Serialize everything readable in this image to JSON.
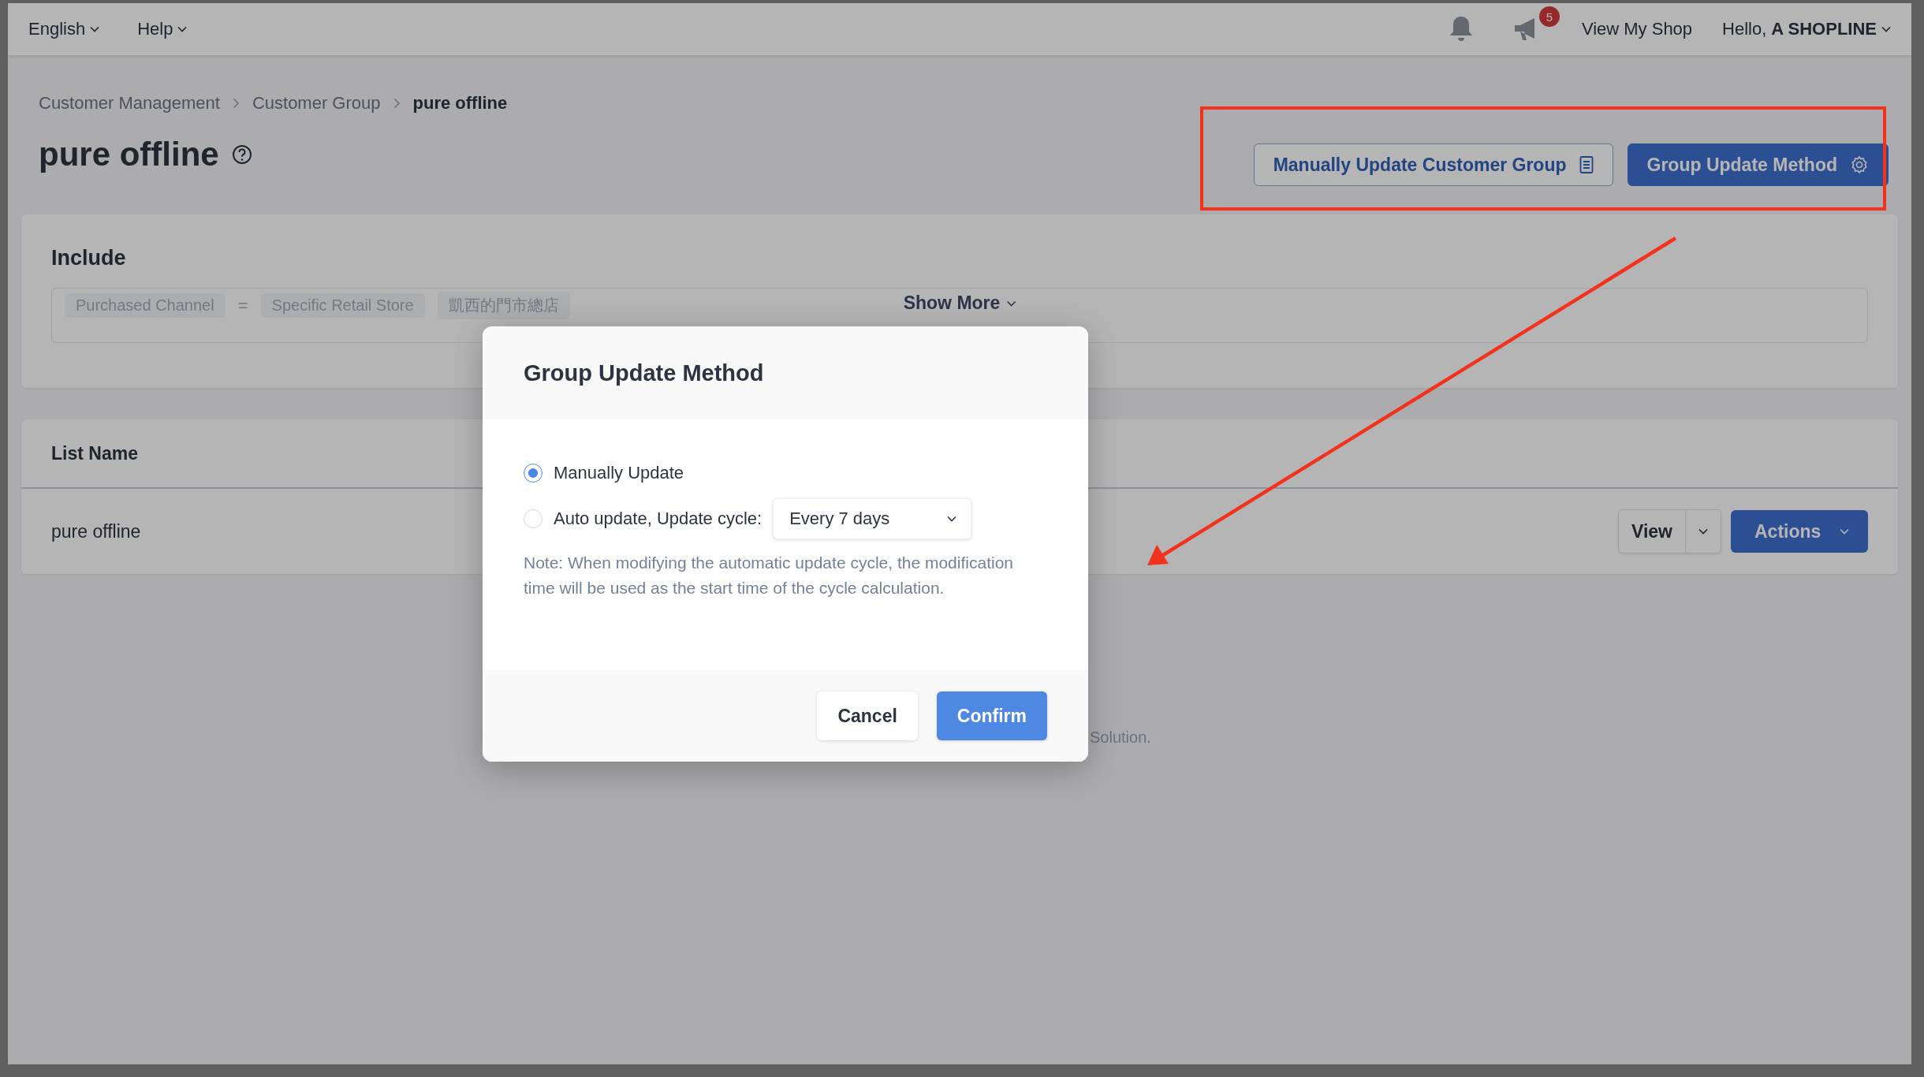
{
  "top_bar": {
    "menus": [
      {
        "label": "English"
      },
      {
        "label": "Help"
      }
    ],
    "notification_badge": "5",
    "view_shop": "View My Shop",
    "greeting": "Hello, **A SHOPLINE**"
  },
  "breadcrumb": [
    {
      "label": "Customer Management",
      "current": false
    },
    {
      "label": "Customer Group",
      "current": false
    },
    {
      "label": "pure offline",
      "current": true
    }
  ],
  "page_title": "pure offline",
  "header_buttons": [
    {
      "label": "Manually Update Customer Group",
      "kind": "outline"
    },
    {
      "label": "Group Update Method",
      "kind": "primary"
    }
  ],
  "include": {
    "title": "Include",
    "conditions": [
      "Purchased Channel",
      "=",
      "Specific Retail Store",
      "凱西的門市總店"
    ],
    "show_more": "Show More"
  },
  "list": {
    "columns": [
      "List Name"
    ],
    "rows": [
      {
        "name": "pure offline",
        "view": "View",
        "actions": "Actions"
      }
    ]
  },
  "footer_fragment": "Solution.",
  "dialog": {
    "title": "Group Update Method",
    "options": [
      {
        "label": "Manually Update",
        "selected": true
      },
      {
        "label": "Auto update, Update cycle:",
        "selected": false,
        "select_value": "Every 7 days"
      }
    ],
    "note": "Note: When modifying the automatic update cycle, the modification time will be used as the start time of the cycle calculation.",
    "buttons": [
      {
        "label": "Cancel",
        "kind": "secondary"
      },
      {
        "label": "Confirm",
        "kind": "primary"
      }
    ]
  }
}
